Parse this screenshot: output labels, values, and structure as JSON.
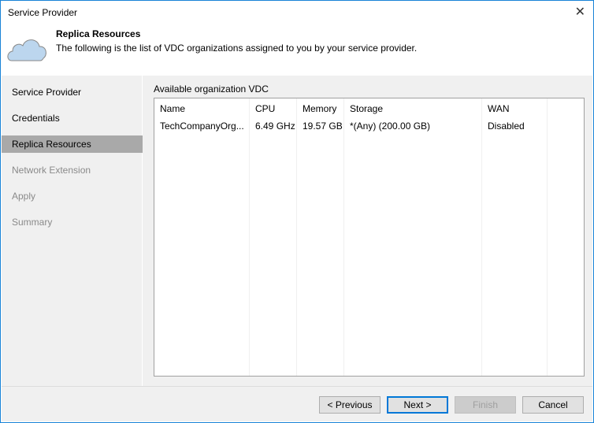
{
  "window": {
    "title": "Service Provider"
  },
  "header": {
    "title": "Replica Resources",
    "description": "The following is the list of VDC organizations assigned to you by your service provider."
  },
  "sidebar": {
    "items": [
      {
        "label": "Service Provider",
        "state": "done"
      },
      {
        "label": "Credentials",
        "state": "done"
      },
      {
        "label": "Replica Resources",
        "state": "selected"
      },
      {
        "label": "Network Extension",
        "state": "disabled"
      },
      {
        "label": "Apply",
        "state": "disabled"
      },
      {
        "label": "Summary",
        "state": "disabled"
      }
    ]
  },
  "main": {
    "list_label": "Available organization VDC",
    "columns": [
      "Name",
      "CPU",
      "Memory",
      "Storage",
      "WAN"
    ],
    "rows": [
      [
        "TechCompanyOrg...",
        "6.49 GHz",
        "19.57 GB",
        "*(Any) (200.00 GB)",
        "Disabled"
      ]
    ]
  },
  "footer": {
    "previous": "< Previous",
    "next": "Next >",
    "finish": "Finish",
    "cancel": "Cancel"
  }
}
